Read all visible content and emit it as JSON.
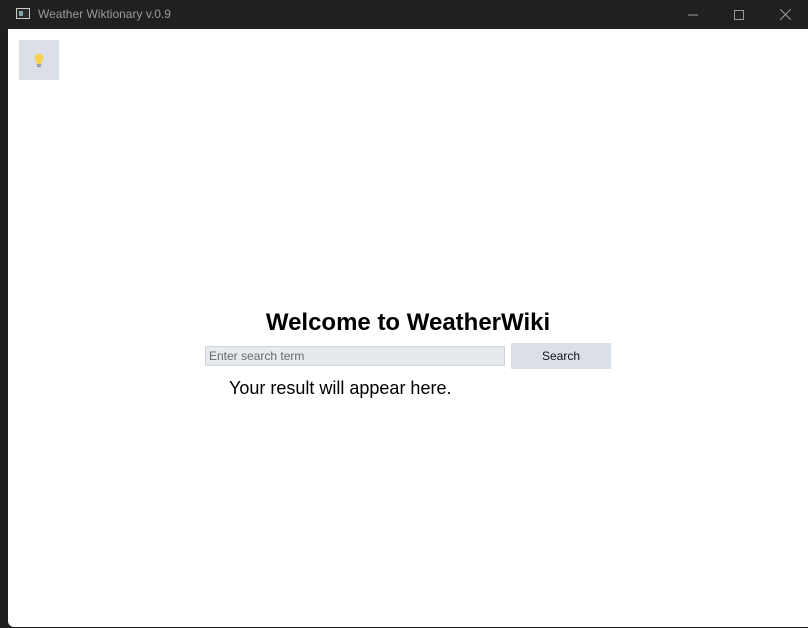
{
  "window": {
    "title": "Weather Wiktionary v.0.9"
  },
  "toolbar": {
    "hint_button_icon": "lightbulb-icon"
  },
  "main": {
    "heading": "Welcome to WeatherWiki",
    "search": {
      "placeholder": "Enter search term",
      "value": "",
      "button_label": "Search"
    },
    "result_text": "Your result will appear here."
  },
  "colors": {
    "titlebar_bg": "#202020",
    "client_bg": "#ffffff",
    "button_bg": "#dbdfe8",
    "input_bg": "#e6e9ee",
    "bulb": "#f7d154"
  }
}
